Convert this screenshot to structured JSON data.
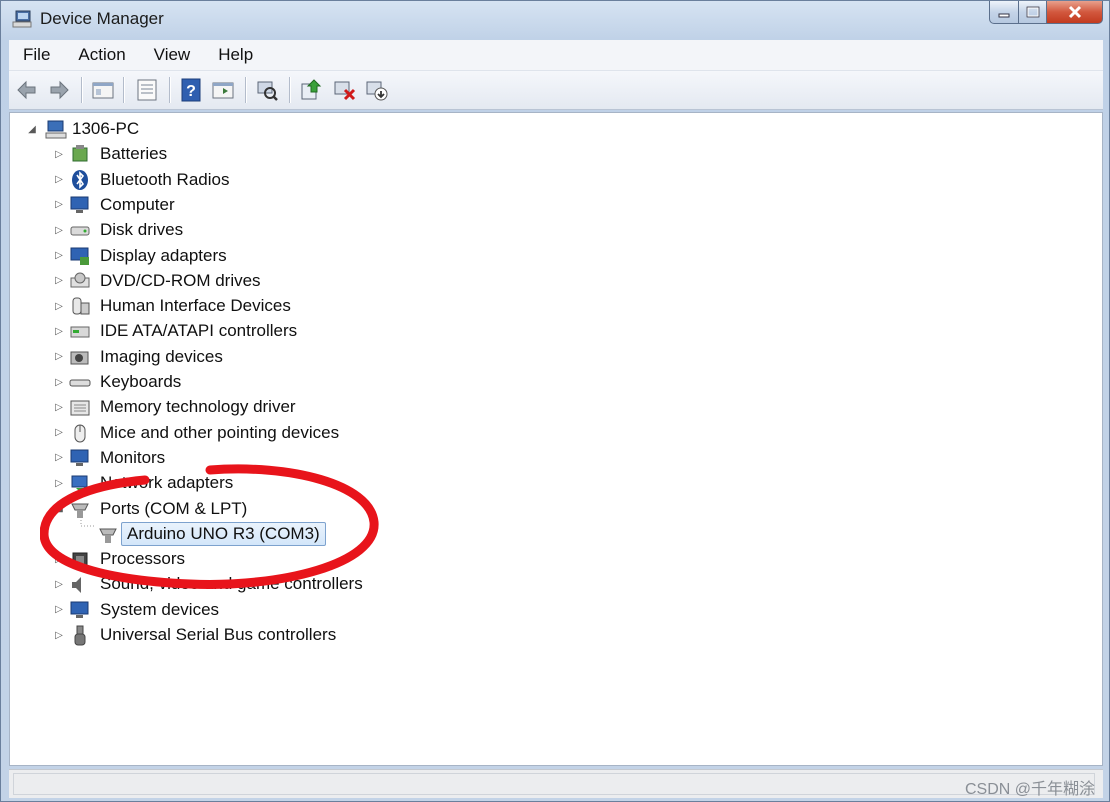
{
  "window": {
    "title": "Device Manager"
  },
  "menu": [
    "File",
    "Action",
    "View",
    "Help"
  ],
  "toolbar": [
    "back-icon",
    "forward-icon",
    "properties-pane-icon",
    "list-view-icon",
    "help-icon",
    "show-hide-icon",
    "scan-hardware-icon",
    "update-driver-icon",
    "uninstall-icon",
    "disable-device-icon"
  ],
  "tree": {
    "root": "1306-PC",
    "categories": [
      "Batteries",
      "Bluetooth Radios",
      "Computer",
      "Disk drives",
      "Display adapters",
      "DVD/CD-ROM drives",
      "Human Interface Devices",
      "IDE ATA/ATAPI controllers",
      "Imaging devices",
      "Keyboards",
      "Memory technology driver",
      "Mice and other pointing devices",
      "Monitors",
      "Network adapters",
      "Ports (COM & LPT)",
      "Processors",
      "Sound, video and game controllers",
      "System devices",
      "Universal Serial Bus controllers"
    ],
    "ports_child": "Arduino UNO R3 (COM3)"
  },
  "watermark": "CSDN @千年糊涂",
  "colors": {
    "highlight_circle": "#e8141b",
    "selection": "#d3e6fa"
  }
}
